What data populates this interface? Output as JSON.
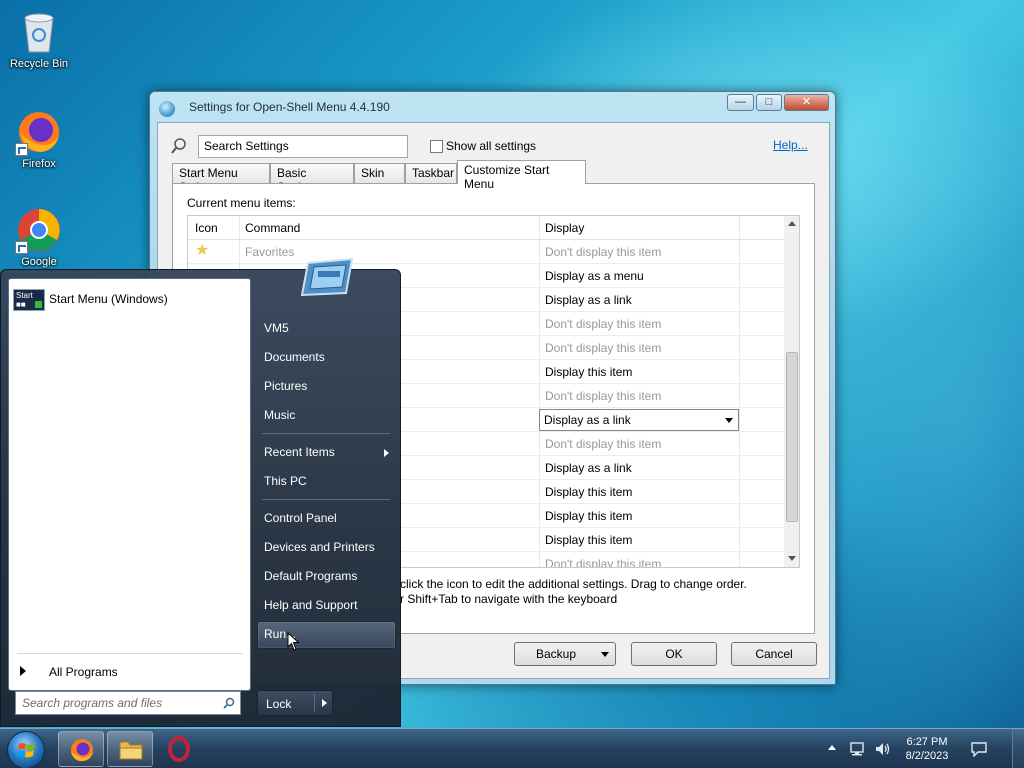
{
  "desktop": {
    "icons": [
      {
        "label": "Recycle Bin",
        "icon": "recycle-bin-icon"
      },
      {
        "label": "Firefox",
        "icon": "firefox-icon"
      },
      {
        "label": "Google",
        "icon": "chrome-icon"
      }
    ]
  },
  "dialog": {
    "title": "Settings for Open-Shell Menu 4.4.190",
    "controls": {
      "minimize": "minimize-icon",
      "maximize": "maximize-icon",
      "close": "close-icon"
    },
    "search": {
      "value": "Search Settings"
    },
    "show_all_label": "Show all settings",
    "help_link": "Help...",
    "tabs": [
      {
        "label": "Start Menu Style"
      },
      {
        "label": "Basic Settings"
      },
      {
        "label": "Skin"
      },
      {
        "label": "Taskbar"
      },
      {
        "label": "Customize Start Menu",
        "active": true
      }
    ],
    "current_items_label": "Current menu items:",
    "columns": {
      "icon": "Icon",
      "command": "Command",
      "display": "Display"
    },
    "rows": [
      {
        "command": "Favorites",
        "display": "Don't display this item",
        "dim": true
      },
      {
        "command": "Recent Items",
        "display": "Display as a menu",
        "dim": false
      },
      {
        "command": "",
        "display": "Display as a link",
        "dim": false
      },
      {
        "command": "",
        "display": "Don't display this item",
        "dim": true
      },
      {
        "command": "",
        "display": "Don't display this item",
        "dim": true
      },
      {
        "command": "",
        "display": "Display this item",
        "dim": false
      },
      {
        "command": "",
        "display": "Don't display this item",
        "dim": true
      },
      {
        "command": "",
        "display": "Display as a link",
        "dim": false,
        "dropdown": true
      },
      {
        "command": "",
        "display": "Don't display this item",
        "dim": true
      },
      {
        "command": "",
        "display": "Display as a link",
        "dim": false
      },
      {
        "command": "",
        "display": "Display this item",
        "dim": false
      },
      {
        "command": "",
        "display": "Display this item",
        "dim": false
      },
      {
        "command": "",
        "display": "Display this item",
        "dim": false
      },
      {
        "command": "",
        "display": "Don't display this item",
        "dim": true
      }
    ],
    "hint_line1": "click the icon to edit the additional settings. Drag to change order.",
    "hint_line2": "r Shift+Tab to navigate with the keyboard",
    "buttons": {
      "backup": "Backup",
      "ok": "OK",
      "cancel": "Cancel"
    }
  },
  "start_menu": {
    "pinned": [
      {
        "label": "Start Menu (Windows)"
      }
    ],
    "all_programs": "All Programs",
    "search_placeholder": "Search programs and files",
    "right_items": [
      {
        "label": "VM5"
      },
      {
        "label": "Documents"
      },
      {
        "label": "Pictures"
      },
      {
        "label": "Music"
      },
      {
        "label": "Recent Items",
        "submenu": true
      },
      {
        "label": "This PC"
      },
      {
        "label": "Control Panel"
      },
      {
        "label": "Devices and Printers"
      },
      {
        "label": "Default Programs"
      },
      {
        "label": "Help and Support"
      },
      {
        "label": "Run...",
        "hovered": true
      }
    ],
    "lock_label": "Lock"
  },
  "taskbar": {
    "apps": [
      "firefox-icon",
      "file-explorer-icon",
      "opera-icon"
    ],
    "time": "6:27 PM",
    "date": "8/2/2023"
  }
}
